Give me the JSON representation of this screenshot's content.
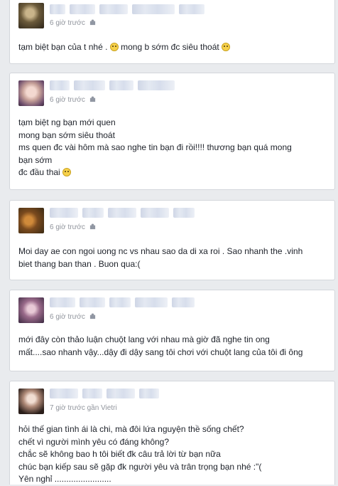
{
  "posts": [
    {
      "meta": "6 giờ trước",
      "lines": [
        "tạm biệt bạn của t nhé .",
        "mong b sớm đc siêu thoát"
      ],
      "emojis": [
        "sad-emoji-icon",
        "dizzy-emoji-icon"
      ]
    },
    {
      "meta": "6 giờ trước",
      "lines": [
        "tạm biệt ng bạn mới quen",
        "mong bạn sớm siêu thoát",
        "ms quen đc vài hôm mà sao nghe tin bạn đi rồi!!!! thương bạn quá mong",
        "bạn sớm",
        "đc đầu thai"
      ],
      "emojis": [
        "sad-emoji-icon"
      ]
    },
    {
      "meta": "6 giờ trước",
      "lines": [
        "Moi day ae con ngoi uong nc vs nhau sao da di xa roi . Sao nhanh the .vinh",
        "biet thang ban than . Buon qua:("
      ]
    },
    {
      "meta": "6 giờ trước",
      "lines": [
        "mới đây còn thảo luận chuột lang với nhau mà giờ đã nghe tin ong",
        "mất....sao nhanh vậy...dậy đi dậy sang tôi chơi với chuột lang của tôi đi ông"
      ]
    },
    {
      "meta": "7 giờ trước gần Vietri",
      "lines": [
        "hỏi thế gian tình ái là chi, mà đôi lứa nguyện thề sống chết?",
        "chết vì người mình yêu có đáng không?",
        "chắc sẽ không bao h tôi biết đk câu trả lời từ bạn nữa",
        "chúc bạn kiếp sau sẽ gặp đk người yêu và trân trọng bạn nhé :\"(",
        "Yên nghỉ ........................"
      ]
    }
  ],
  "colors": {
    "background": "#e9ebee",
    "card": "#ffffff",
    "meta_text": "#90949c",
    "body_text": "#1d2129"
  }
}
